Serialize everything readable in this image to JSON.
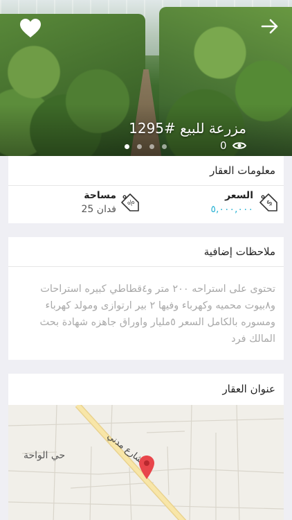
{
  "hero": {
    "title": "مزرعة للبيع #1295",
    "views_count": "0",
    "slides_total": 4,
    "active_slide": 1
  },
  "icons": {
    "favorite": "heart-icon",
    "back": "arrow-right-icon",
    "views": "eye-icon",
    "price": "tag-dollar-icon",
    "area": "tag-percent-icon",
    "map_pin": "map-pin-icon"
  },
  "property_info": {
    "header": "معلومات العقار",
    "price_label": "السعر",
    "price_value": "٥,٠٠٠,٠٠٠",
    "area_label": "مساحة",
    "area_value": "25 فدان"
  },
  "notes": {
    "header": "ملاحظات إضافية",
    "text": "تحتوى على استراحه ٢٠٠ متر و٤قطاطي كبيره استراحات و٨بيوت محميه وكهرباء وفيها ٢ بير ارتوازى ومولد كهرباء ومسوره بالكامل السعر ٥مليار واوراق جاهزه شهادة بحث المالك فرد"
  },
  "address": {
    "header": "عنوان العقار",
    "district_label": "حي الواحة",
    "street_label": "شارع مدني"
  },
  "colors": {
    "accent": "#2bb3d4",
    "background": "#efeff4",
    "road": "#f2d98a",
    "pin": "#e8464b"
  }
}
